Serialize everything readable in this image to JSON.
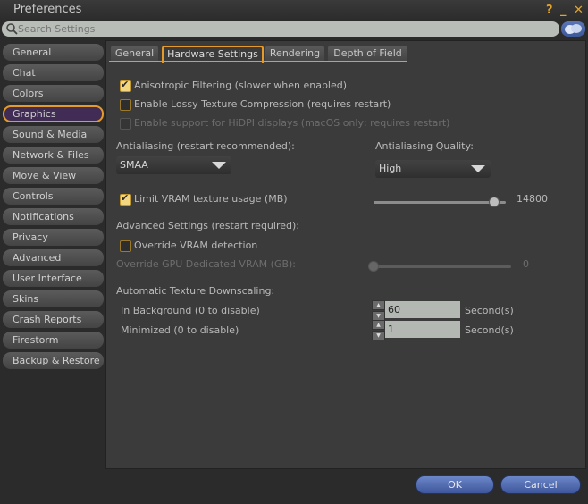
{
  "window": {
    "title": "Preferences"
  },
  "search": {
    "placeholder": "Search Settings"
  },
  "sidebar": {
    "items": [
      "General",
      "Chat",
      "Colors",
      "Graphics",
      "Sound & Media",
      "Network & Files",
      "Move & View",
      "Controls",
      "Notifications",
      "Privacy",
      "Advanced",
      "User Interface",
      "Skins",
      "Crash Reports",
      "Firestorm",
      "Backup & Restore"
    ],
    "active": "Graphics"
  },
  "tabs": [
    "General",
    "Hardware Settings",
    "Rendering",
    "Depth of Field"
  ],
  "active_tab": "Hardware Settings",
  "settings": {
    "anisotropic": {
      "label": "Anisotropic Filtering (slower when enabled)",
      "checked": true
    },
    "lossy": {
      "label": "Enable Lossy Texture Compression (requires restart)",
      "checked": false
    },
    "hidpi": {
      "label": "Enable support for HiDPI displays (macOS only; requires restart)",
      "checked": false,
      "disabled": true
    },
    "antialiasing": {
      "label": "Antialiasing (restart recommended):",
      "value": "SMAA"
    },
    "aa_quality": {
      "label": "Antialiasing Quality:",
      "value": "High"
    },
    "vram_limit": {
      "label": "Limit VRAM texture usage (MB)",
      "checked": true,
      "value": "14800",
      "level": 0.95
    },
    "advanced_header": "Advanced Settings (restart required):",
    "override_vram": {
      "label": "Override VRAM detection",
      "checked": false
    },
    "gpu_vram": {
      "label": "Override GPU Dedicated VRAM (GB):",
      "value": "0",
      "level": 0
    },
    "downscale_header": "Automatic Texture Downscaling:",
    "in_background": {
      "label": "In Background (0 to disable)",
      "value": "60",
      "unit": "Second(s)"
    },
    "minimized": {
      "label": "Minimized (0 to disable)",
      "value": "1",
      "unit": "Second(s)"
    }
  },
  "buttons": {
    "ok": "OK",
    "cancel": "Cancel"
  },
  "colors": {
    "accent": "#e49b2b",
    "button": "#4f6bb0",
    "active_bg": "#412c55"
  }
}
